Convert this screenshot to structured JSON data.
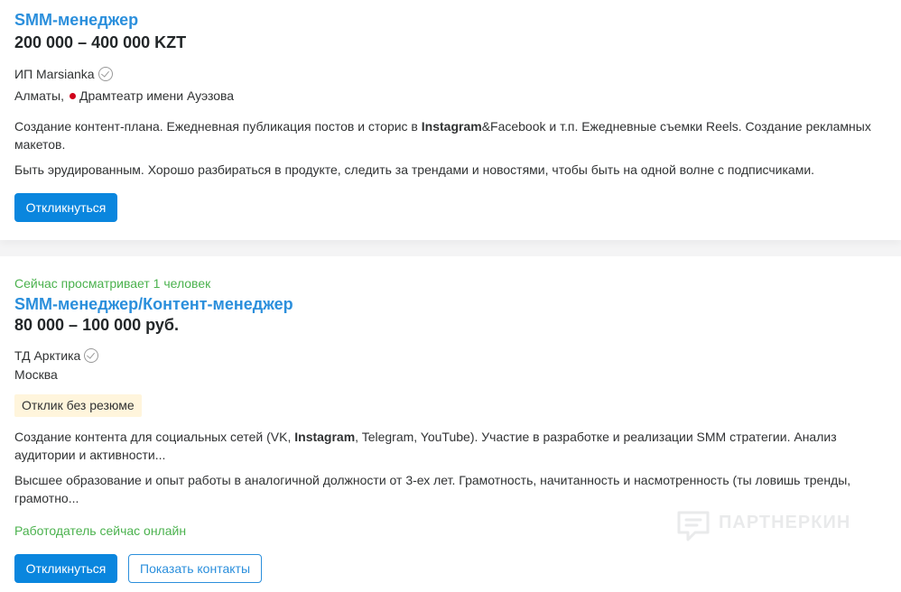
{
  "vacancies": [
    {
      "title": "SMM-менеджер",
      "salary": "200 000 – 400 000 KZT",
      "company": "ИП Marsianka",
      "location_city": "Алматы,",
      "location_metro": "Драмтеатр имени Ауэзова",
      "metro_color": "#d0021b",
      "desc1_before": "Создание контент-плана. Ежедневная публикация постов и сторис в ",
      "desc1_bold": "Instagram",
      "desc1_after": "&Facebook и т.п. Ежедневные съемки Reels. Создание рекламных макетов.",
      "desc2": "Быть эрудированным. Хорошо разбираться в продукте, следить за трендами и новостями, чтобы быть на одной волне с подписчиками.",
      "apply_label": "Откликнуться"
    },
    {
      "viewing_now": "Сейчас просматривает 1 человек",
      "title": "SMM-менеджер/Контент-менеджер",
      "salary": "80 000 – 100 000 руб.",
      "company": "ТД Арктика",
      "location_city": "Москва",
      "badge": "Отклик без резюме",
      "desc1_before": "Создание контента для социальных сетей (VK, ",
      "desc1_bold": "Instagram",
      "desc1_after": ", Telegram, YouTube). Участие в разработке и реализации SMM стратегии. Анализ аудитории и активности...",
      "desc2": "Высшее образование и опыт работы в аналогичной должности от 3-ех лет. Грамотность, начитанность и насмотренность (ты ловишь тренды, грамотно...",
      "employer_online": "Работодатель сейчас онлайн",
      "apply_label": "Откликнуться",
      "contacts_label": "Показать контакты"
    }
  ],
  "watermark": {
    "text": "ПАРТНЕРКИН",
    "icon": "partnerkin-logo-icon"
  },
  "colors": {
    "title_link": "#2b8fdc",
    "primary_button": "#0a86de",
    "green_status": "#4bb24e",
    "badge_bg": "#fff5dc"
  }
}
